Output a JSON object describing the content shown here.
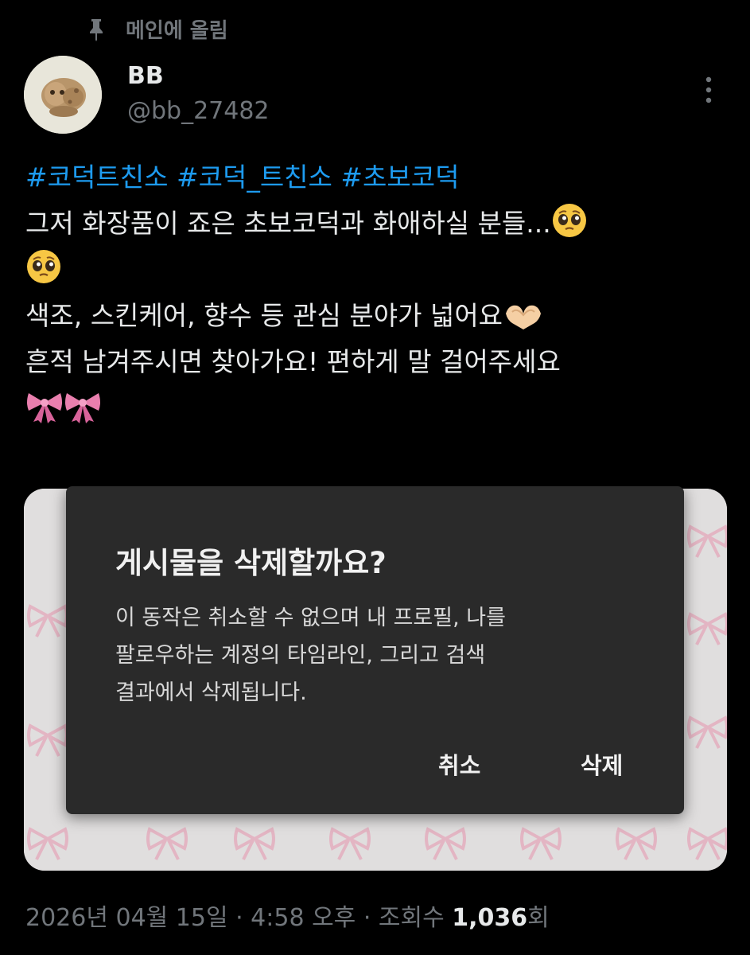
{
  "pinned": {
    "label": "메인에 올림",
    "icon": "pin-icon"
  },
  "author": {
    "display_name": "BB",
    "handle": "@bb_27482",
    "avatar": "avatar"
  },
  "menu_icon": "more-vertical-icon",
  "tweet": {
    "hashtags": [
      "#코덕트친소",
      "#코덕_트친소",
      "#초보코덕"
    ],
    "line1": "그저 화장품이 죠은 초보코덕과 화애하실 분들...",
    "line3": "색조, 스킨케어, 향수 등 관심 분야가 넓어요",
    "line4": "흔적 남겨주시면 찾아가요! 편하게 말 걸어주세요",
    "emojis": [
      "pleading-face-emoji",
      "pleading-face-emoji",
      "heart-hands-emoji",
      "ribbon-emoji",
      "ribbon-emoji"
    ]
  },
  "dialog": {
    "title": "게시물을 삭제할까요?",
    "body_lines": [
      "이 동작은 취소할 수 없으며 내 프로필, 나를",
      "팔로우하는 계정의 타임라인, 그리고 검색",
      "결과에서 삭제됩니다."
    ],
    "cancel_label": "취소",
    "delete_label": "삭제"
  },
  "meta": {
    "timestamp": "2026년 04월 15일 · 4:58 오후 · 조회수",
    "views": "1,036",
    "views_suffix": "회"
  },
  "colors": {
    "background": "#000000",
    "hashtag": "#1d9bf0",
    "secondary_text": "#71767b",
    "dialog_bg": "#2a2a2a",
    "ribbon_pink": "#e97fae"
  }
}
